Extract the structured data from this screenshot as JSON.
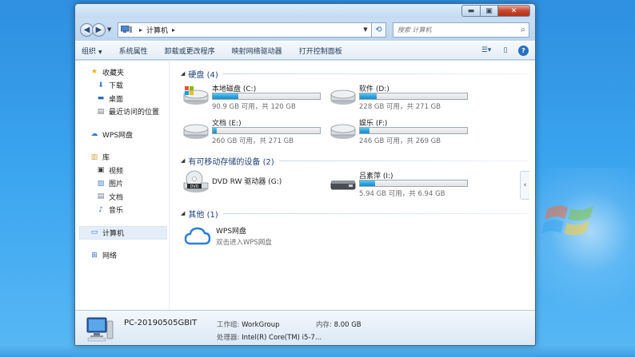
{
  "window": {
    "caption": {
      "minimize": "▬",
      "maximize": "▣",
      "close": "✕"
    }
  },
  "address": {
    "segment": "计算机",
    "search_placeholder": "搜索 计算机"
  },
  "toolbar": {
    "organize": "组织",
    "properties": "系统属性",
    "uninstall": "卸载或更改程序",
    "map_drive": "映射网络驱动器",
    "control_panel": "打开控制面板"
  },
  "sidebar": {
    "favorites": {
      "label": "收藏夹",
      "items": [
        "下载",
        "桌面",
        "最近访问的位置"
      ]
    },
    "wps": "WPS网盘",
    "libraries": {
      "label": "库",
      "items": [
        "视频",
        "图片",
        "文档",
        "音乐"
      ]
    },
    "computer": "计算机",
    "network": "网络"
  },
  "sections": {
    "hdd": "硬盘 (4)",
    "removable": "有可移动存储的设备 (2)",
    "other": "其他 (1)"
  },
  "drives": [
    {
      "name": "本地磁盘 (C:)",
      "info": "90.9 GB 可用，共 120 GB",
      "used_pct": 24
    },
    {
      "name": "软件 (D:)",
      "info": "228 GB 可用，共 271 GB",
      "used_pct": 16
    },
    {
      "name": "文档 (E:)",
      "info": "260 GB 可用，共 271 GB",
      "used_pct": 4
    },
    {
      "name": "娱乐 (F:)",
      "info": "246 GB 可用，共 269 GB",
      "used_pct": 9
    }
  ],
  "removable": [
    {
      "name": "DVD RW 驱动器 (G:)"
    },
    {
      "name": "吕素萍 (I:)",
      "info": "5.94 GB 可用，共 6.94 GB",
      "used_pct": 14
    }
  ],
  "other_items": [
    {
      "name": "WPS网盘",
      "desc": "双击进入WPS网盘"
    }
  ],
  "details": {
    "pc_name": "PC-20190505GBIT",
    "workgroup_label": "工作组:",
    "workgroup": "WorkGroup",
    "memory_label": "内存:",
    "memory": "8.00 GB",
    "cpu_label": "处理器:",
    "cpu": "Intel(R) Core(TM) i5-7..."
  },
  "colors": {
    "progress": "#26a0da",
    "desktop": "#3aa4ef",
    "section_header": "#1e3f7a"
  }
}
